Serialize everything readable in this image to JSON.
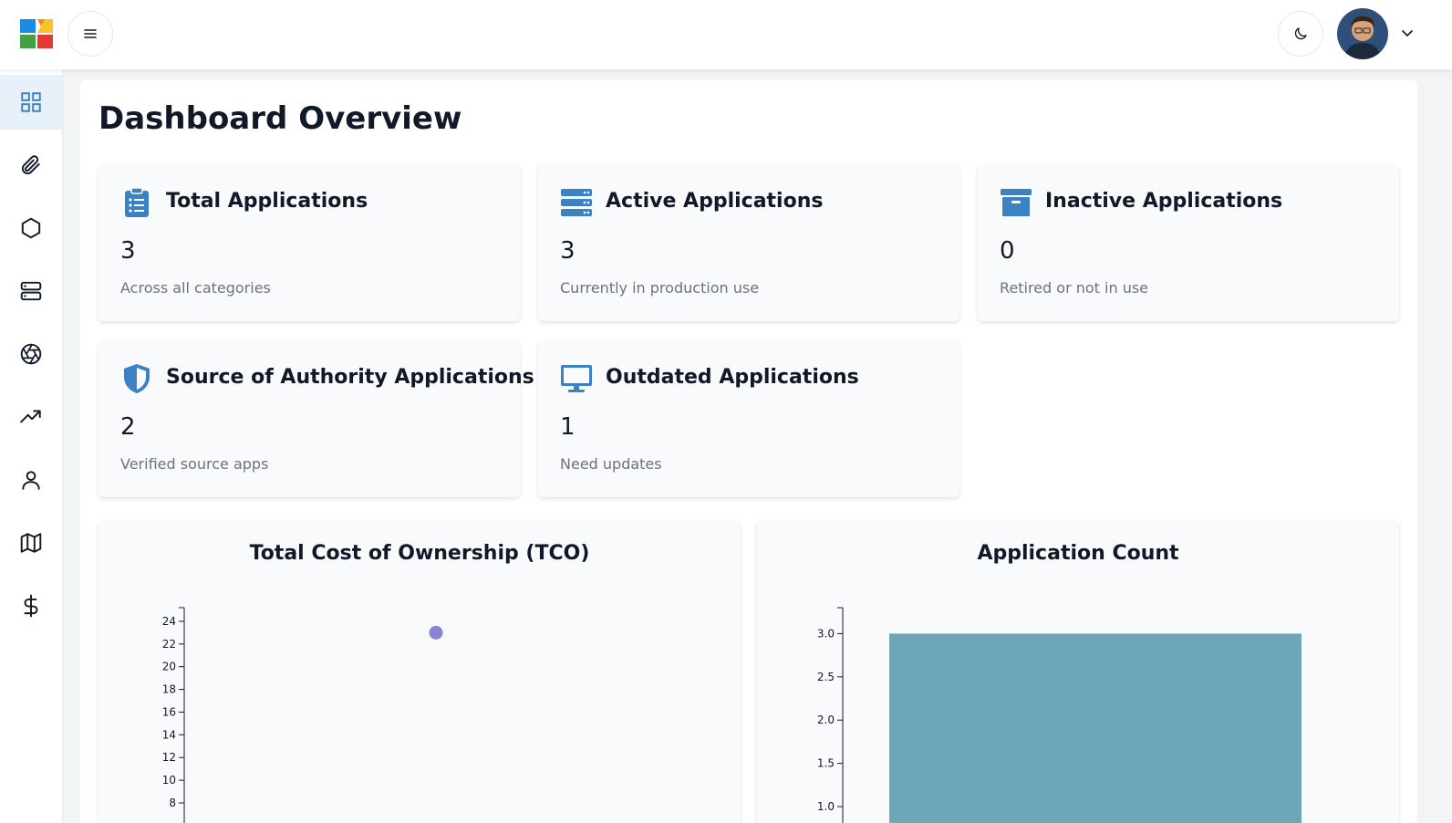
{
  "header": {
    "logo_icon": "app-logo-icon",
    "menu_icon": "hamburger-menu-icon",
    "theme_icon": "moon-icon",
    "user_icon": "user-avatar",
    "dropdown_icon": "chevron-down-icon"
  },
  "sidebar": {
    "items": [
      {
        "icon": "dashboard-grid-icon",
        "active": true
      },
      {
        "icon": "paperclip-icon",
        "active": false
      },
      {
        "icon": "hexagon-icon",
        "active": false
      },
      {
        "icon": "server-icon",
        "active": false
      },
      {
        "icon": "aperture-icon",
        "active": false
      },
      {
        "icon": "trending-up-icon",
        "active": false
      },
      {
        "icon": "user-icon",
        "active": false
      },
      {
        "icon": "map-icon",
        "active": false
      },
      {
        "icon": "dollar-icon",
        "active": false
      }
    ]
  },
  "page": {
    "title": "Dashboard Overview"
  },
  "stats": [
    {
      "title": "Total Applications",
      "value": "3",
      "subtitle": "Across all categories",
      "icon": "clipboard-list-icon"
    },
    {
      "title": "Active Applications",
      "value": "3",
      "subtitle": "Currently in production use",
      "icon": "server-stack-icon"
    },
    {
      "title": "Inactive Applications",
      "value": "0",
      "subtitle": "Retired or not in use",
      "icon": "archive-box-icon"
    },
    {
      "title": "Source of Authority Applications",
      "value": "2",
      "subtitle": "Verified source apps",
      "icon": "shield-icon"
    },
    {
      "title": "Outdated Applications",
      "value": "1",
      "subtitle": "Need updates",
      "icon": "monitor-icon"
    }
  ],
  "colors": {
    "accent": "#3b82c4",
    "scatter_point": "#8a84d6",
    "bar": "#6da6b8"
  },
  "chart_data": [
    {
      "type": "scatter",
      "title": "Total Cost of Ownership (TCO)",
      "xlabel": "",
      "ylabel": "",
      "y_ticks": [
        8,
        10,
        12,
        14,
        16,
        18,
        20,
        22,
        24
      ],
      "ylim": [
        8,
        25.2
      ],
      "points": [
        {
          "y": 23
        }
      ]
    },
    {
      "type": "bar",
      "title": "Application Count",
      "xlabel": "",
      "ylabel": "",
      "y_ticks": [
        1.0,
        1.5,
        2.0,
        2.5,
        3.0
      ],
      "ylim": [
        1.0,
        3.3
      ],
      "values": [
        3
      ]
    }
  ]
}
